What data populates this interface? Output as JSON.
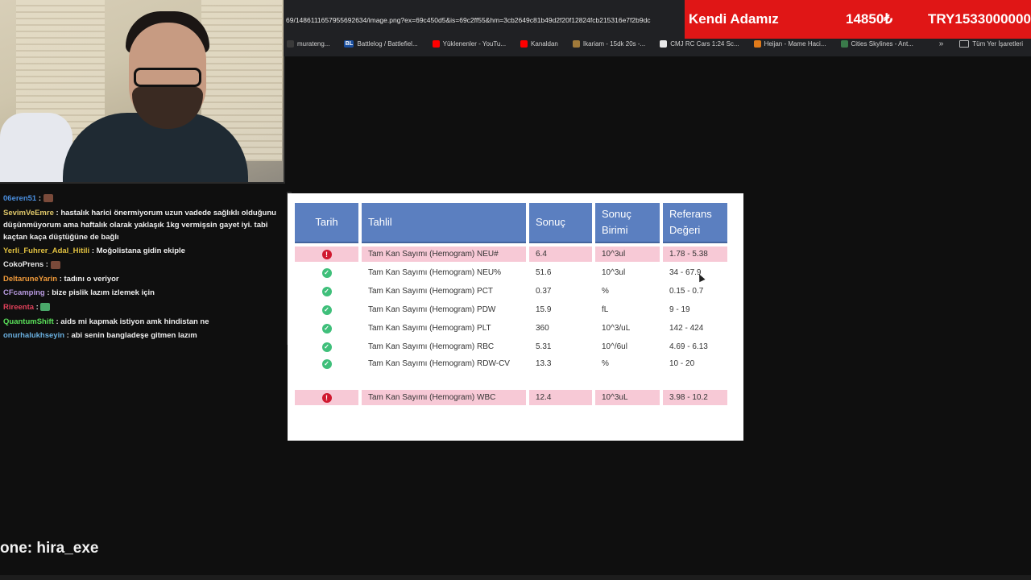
{
  "browser": {
    "url": "69/1486111657955692634/image.png?ex=69c450d5&is=69c2ff55&hm=3cb2649c81b49d2f20f12824fcb215316e7f2b9dc",
    "bookmarks": [
      {
        "label": "murateng...",
        "icon": "bookmark-icon",
        "color": "#3a3a3a"
      },
      {
        "label": "Battlelog / Battlefiel...",
        "icon": "BL",
        "color": "#1a4fa0"
      },
      {
        "label": "Yüklenenler - YouTu...",
        "icon": "youtube-icon",
        "color": "#ff0000"
      },
      {
        "label": "Kanaldan",
        "icon": "youtube-icon",
        "color": "#ff0000"
      },
      {
        "label": "Ikariam - 15dk 20s -...",
        "icon": "game-icon",
        "color": "#a07a3a"
      },
      {
        "label": "CMJ RC Cars 1:24 Sc...",
        "icon": "amazon-icon",
        "color": "#e8e8e8"
      },
      {
        "label": "Heijan - Mame Haci...",
        "icon": "store-icon",
        "color": "#e07a1a"
      },
      {
        "label": "Cities Skylines - Ant...",
        "icon": "game-icon",
        "color": "#3a7a4a"
      }
    ],
    "more": "»",
    "all_bookmarks": "Tüm Yer İşaretleri"
  },
  "donation": {
    "name": "Kendi Adamız",
    "amount": "14850₺",
    "goal": "TRY1533000000"
  },
  "chat": [
    {
      "user": "06eren51",
      "color": "#4a8fe0",
      "text": "",
      "emote": "brown"
    },
    {
      "user": "SevimVeEmre",
      "color": "#e0c86a",
      "text": "hastalık harici önermiyorum uzun vadede sağlıklı olduğunu düşünmüyorum ama haftalık olarak yaklaşık 1kg vermişsin gayet iyi. tabi kaçtan kaça düştüğüne de bağlı",
      "wrap": true
    },
    {
      "user": "Yerli_Fuhrer_Adal_Hitili",
      "color": "#e0c040",
      "text": "Moğolistana gidin ekiple"
    },
    {
      "user": "CokoPrens",
      "color": "#e8e8e8",
      "text": "",
      "emote": "brown"
    },
    {
      "user": "DeltaruneYarin",
      "color": "#f09a3a",
      "text": "tadını o veriyor"
    },
    {
      "user": "CFcamping",
      "color": "#b89ae0",
      "text": "bize pislik lazım izlemek için"
    },
    {
      "user": "Rireenta",
      "color": "#e0405a",
      "text": "",
      "emote": "green"
    },
    {
      "user": "QuantumShift",
      "color": "#5ae05a",
      "text": "aids mi kapmak istiyon amk hindistan ne"
    },
    {
      "user": "onurhalukhseyin",
      "color": "#6ab0e0",
      "text": "abi senin bangladeşe gitmen lazım"
    }
  ],
  "table": {
    "headers": [
      "Tarih",
      "Tahlil",
      "Sonuç",
      "Sonuç Birimi",
      "Referans Değeri"
    ],
    "rows": [
      {
        "status": "error",
        "test": "Tam Kan Sayımı (Hemogram) NEU#",
        "result": "6.4",
        "unit": "10^3ul",
        "ref": "1.78 - 5.38"
      },
      {
        "status": "ok",
        "test": "Tam Kan Sayımı (Hemogram) NEU%",
        "result": "51.6",
        "unit": "10^3ul",
        "ref": "34 - 67.9"
      },
      {
        "status": "ok",
        "test": "Tam Kan Sayımı (Hemogram) PCT",
        "result": "0.37",
        "unit": "%",
        "ref": "0.15 - 0.7"
      },
      {
        "status": "ok",
        "test": "Tam Kan Sayımı (Hemogram) PDW",
        "result": "15.9",
        "unit": "fL",
        "ref": "9 - 19"
      },
      {
        "status": "ok",
        "test": "Tam Kan Sayımı (Hemogram) PLT",
        "result": "360",
        "unit": "10^3/uL",
        "ref": "142 - 424"
      },
      {
        "status": "ok",
        "test": "Tam Kan Sayımı (Hemogram) RBC",
        "result": "5.31",
        "unit": "10^/6ul",
        "ref": "4.69 - 6.13"
      },
      {
        "status": "ok",
        "test": "Tam Kan Sayımı (Hemogram) RDW-CV",
        "result": "13.3",
        "unit": "%",
        "ref": "10 - 20"
      },
      {
        "status": "error",
        "test": "Tam Kan Sayımı (Hemogram) WBC",
        "result": "12.4",
        "unit": "10^3uL",
        "ref": "3.98 - 10.2"
      }
    ]
  },
  "bottom_text": "one: hira_exe"
}
